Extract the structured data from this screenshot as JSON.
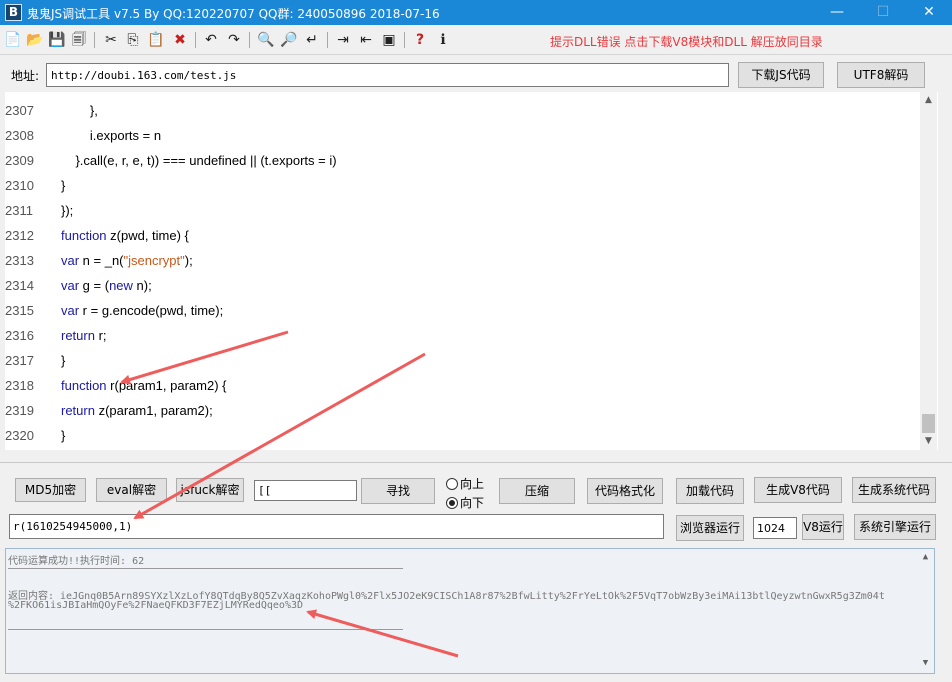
{
  "window": {
    "app_icon_letter": "B",
    "title": "鬼鬼JS调试工具 v7.5 By QQ:120220707  QQ群: 240050896  2018-07-16",
    "min_glyph": "—",
    "max_glyph": "☐",
    "close_glyph": "✕"
  },
  "toolbar": {
    "icons": {
      "new": "📄",
      "open": "📂",
      "save": "💾",
      "save_all": "🗐",
      "cut": "✂",
      "copy": "⎘",
      "paste": "📋",
      "delete": "✖",
      "undo": "↶",
      "redo": "↷",
      "find": "🔍",
      "find_next": "🔎",
      "replace": "↵",
      "indent": "⇥",
      "outdent": "⇤",
      "window": "▣",
      "help": "?",
      "info": "ℹ"
    },
    "notice": "提示DLL错误  点击下载V8模块和DLL  解压放同目录"
  },
  "address": {
    "label": "地址:",
    "value": "http://doubi.163.com/test.js",
    "download_button": "下载JS代码",
    "utf8_button": "UTF8解码"
  },
  "editor": {
    "lines": [
      {
        "num": "2307",
        "indent": "        ",
        "tokens": [
          {
            "t": "},",
            "c": ""
          }
        ]
      },
      {
        "num": "2308",
        "indent": "        ",
        "tokens": [
          {
            "t": "i.exports = n",
            "c": ""
          }
        ]
      },
      {
        "num": "2309",
        "indent": "    ",
        "tokens": [
          {
            "t": "}.call(e, r, e, t)) === undefined || (t.exports = i)",
            "c": ""
          }
        ]
      },
      {
        "num": "2310",
        "indent": "",
        "tokens": [
          {
            "t": "}",
            "c": ""
          }
        ]
      },
      {
        "num": "2311",
        "indent": "",
        "tokens": [
          {
            "t": "});",
            "c": ""
          }
        ]
      },
      {
        "num": "2312",
        "indent": "",
        "tokens": [
          {
            "t": "function",
            "c": "kw"
          },
          {
            "t": " z(pwd, time) {",
            "c": ""
          }
        ]
      },
      {
        "num": "2313",
        "indent": "",
        "tokens": [
          {
            "t": "var",
            "c": "kw"
          },
          {
            "t": " n = _n(",
            "c": ""
          },
          {
            "t": "\"jsencrypt\"",
            "c": "str"
          },
          {
            "t": ");",
            "c": ""
          }
        ]
      },
      {
        "num": "2314",
        "indent": "",
        "tokens": [
          {
            "t": "var",
            "c": "kw"
          },
          {
            "t": " g = (",
            "c": ""
          },
          {
            "t": "new",
            "c": "kw"
          },
          {
            "t": " n);",
            "c": ""
          }
        ]
      },
      {
        "num": "2315",
        "indent": "",
        "tokens": [
          {
            "t": "var",
            "c": "kw"
          },
          {
            "t": " r = g.encode(pwd, time);",
            "c": ""
          }
        ]
      },
      {
        "num": "2316",
        "indent": "",
        "tokens": [
          {
            "t": "return",
            "c": "kw"
          },
          {
            "t": " r;",
            "c": ""
          }
        ]
      },
      {
        "num": "2317",
        "indent": "",
        "tokens": [
          {
            "t": "}",
            "c": ""
          }
        ]
      },
      {
        "num": "2318",
        "indent": "",
        "tokens": [
          {
            "t": "function",
            "c": "kw"
          },
          {
            "t": " r(param1, param2) {",
            "c": ""
          }
        ]
      },
      {
        "num": "2319",
        "indent": "",
        "tokens": [
          {
            "t": "return",
            "c": "kw"
          },
          {
            "t": " z(param1, param2);",
            "c": ""
          }
        ]
      },
      {
        "num": "2320",
        "indent": "",
        "tokens": [
          {
            "t": "}",
            "c": ""
          }
        ]
      }
    ],
    "scroll_up_glyph": "▲",
    "scroll_down_glyph": "▼"
  },
  "controls": {
    "md5_button": "MD5加密",
    "eval_button": "eval解密",
    "jsfuck_button": "jsfuck解密",
    "search_value": "[[",
    "find_button": "寻找",
    "radio_up": "向上",
    "radio_down": "向下",
    "radio_selected": "向下",
    "compress_button": "压缩",
    "format_button": "代码格式化",
    "load_button": "加载代码",
    "gen_v8_button": "生成V8代码",
    "gen_system_button": "生成系统代码",
    "expression_value": "r(1610254945000,1)",
    "browser_run_button": "浏览器运行",
    "stack_size_value": "1024",
    "v8_run_button": "V8运行",
    "system_engine_button": "系统引擎运行"
  },
  "output": {
    "status": "代码运算成功!!执行时间: 62",
    "return_line1": "返回内容: ieJGnq0B5Arn89SYXzlXzLofY8QTdqBy8Q5ZvXaqzKohoPWgl0%2Flx5JO2eK9CISCh1A8r87%2BfwLitty%2FrYeLtOk%2F5VqT7obWzBy3eiMAi13btlQeyzwtnGwxR5g3Zm04t",
    "return_line2": "%2FKO61isJBIaHmQOyFe%2FNaeQFKD3F7EZjLMYRedQqeo%3D",
    "scroll_up_glyph": "▲",
    "scroll_down_glyph": "▼"
  },
  "annotation_color": "#ee5c5c"
}
